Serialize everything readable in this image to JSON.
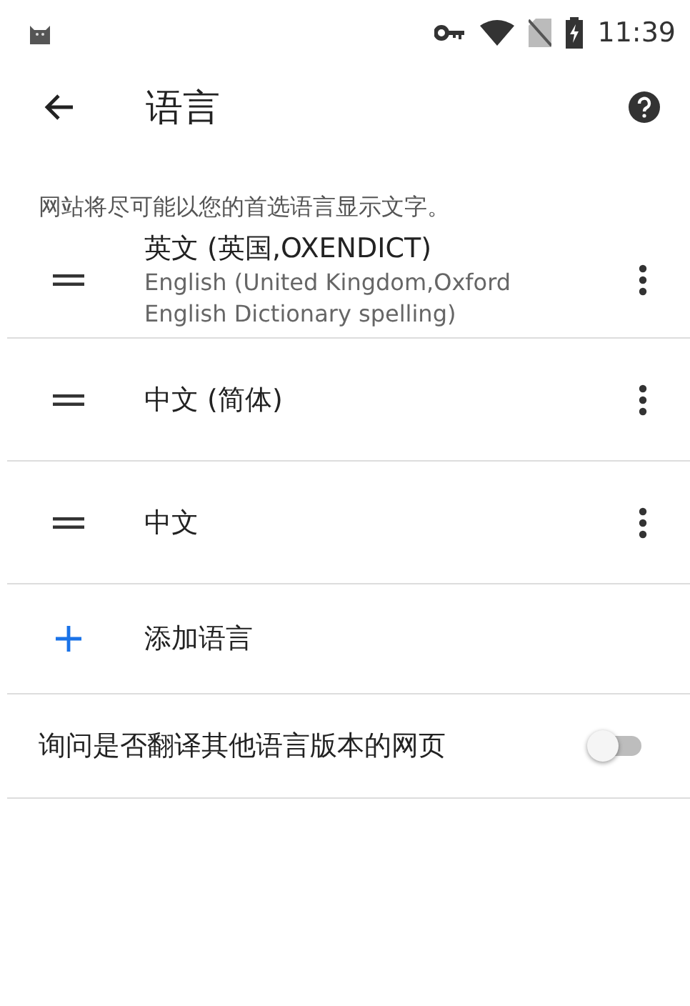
{
  "status_bar": {
    "time": "11:39"
  },
  "toolbar": {
    "title": "语言"
  },
  "description": "网站将尽可能以您的首选语言显示文字。",
  "languages": [
    {
      "title": "英文 (英国,OXENDICT)",
      "subtitle": "English (United Kingdom,Oxford English Dictionary spelling)"
    },
    {
      "title": "中文 (简体)"
    },
    {
      "title": "中文"
    }
  ],
  "add_language": {
    "label": "添加语言"
  },
  "translate_toggle": {
    "label": "询问是否翻译其他语言版本的网页",
    "on": false
  }
}
